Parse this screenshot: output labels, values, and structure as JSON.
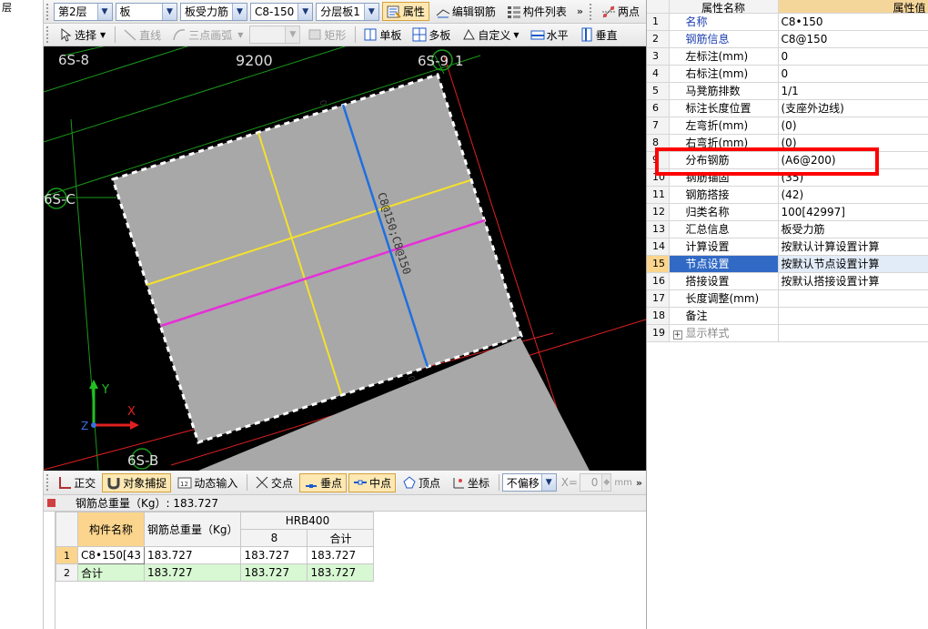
{
  "left_strip": {
    "label": "层"
  },
  "toolbar1": {
    "floor": "第2层",
    "component_type": "板",
    "rebar_type": "板受力筋",
    "rebar_spec": "C8-150",
    "layer": "分层板1",
    "properties_label": "属性",
    "edit_rebar_label": "编辑钢筋",
    "component_list_label": "构件列表",
    "more": "»",
    "two_point_label": "两点"
  },
  "toolbar2": {
    "select_label": "选择",
    "line_label": "直线",
    "arc_label": "三点画弧",
    "rect_label": "矩形",
    "single_label": "单板",
    "multi_label": "多板",
    "custom_label": "自定义",
    "horizontal_label": "水平",
    "vertical_label": "垂直"
  },
  "canvas": {
    "axis_labels": {
      "top_left": "6S-8",
      "top_right": "6S-9",
      "top_right_suffix": "1",
      "dimension": "9200",
      "left": "6S-C",
      "bottom": "6S-B"
    },
    "rebar_label": "C8@150;C8@150",
    "zero_labels": [
      "0",
      "0"
    ],
    "coords": {
      "y": "Y",
      "x": "X",
      "z": "Z"
    },
    "colors": {
      "slab": "#a8a8a8",
      "yellow_rebar": "#f5e12a",
      "magenta_rebar": "#e62fd8",
      "blue_rebar": "#1e6fe0",
      "axis_green": "#1a9a1a",
      "axis_red": "#e02020"
    }
  },
  "toolbar3": {
    "orthogonal_label": "正交",
    "snap_label": "对象捕捉",
    "dynamic_input_label": "动态输入",
    "intersection_label": "交点",
    "perpendicular_label": "垂点",
    "midpoint_label": "中点",
    "vertex_label": "顶点",
    "coordinate_label": "坐标",
    "offset_value": "不偏移",
    "x_label": "X=",
    "x_value": "0",
    "unit": "mm"
  },
  "info_bar": {
    "text": "钢筋总重量（Kg）: 183.727"
  },
  "steel_table": {
    "headers": {
      "component": "构件名称",
      "total_weight": "钢筋总重量（Kg）",
      "grade": "HRB400",
      "dia": "8",
      "sum": "合计"
    },
    "rows": [
      {
        "index": "1",
        "name": "C8•150[43",
        "total": "183.727",
        "d8": "183.727",
        "sum": "183.727"
      },
      {
        "index": "2",
        "name": "合计",
        "total": "183.727",
        "d8": "183.727",
        "sum": "183.727"
      }
    ]
  },
  "property_panel": {
    "header_name": "属性名称",
    "header_value": "属性值",
    "rows": [
      {
        "num": "1",
        "name": "名称",
        "value": "C8•150",
        "style": "blue"
      },
      {
        "num": "2",
        "name": "钢筋信息",
        "value": "C8@150",
        "style": "blue"
      },
      {
        "num": "3",
        "name": "左标注(mm)",
        "value": "0",
        "style": ""
      },
      {
        "num": "4",
        "name": "右标注(mm)",
        "value": "0",
        "style": ""
      },
      {
        "num": "5",
        "name": "马凳筋排数",
        "value": "1/1",
        "style": ""
      },
      {
        "num": "6",
        "name": "标注长度位置",
        "value": "(支座外边线)",
        "style": ""
      },
      {
        "num": "7",
        "name": "左弯折(mm)",
        "value": "(0)",
        "style": ""
      },
      {
        "num": "8",
        "name": "右弯折(mm)",
        "value": "(0)",
        "style": ""
      },
      {
        "num": "9",
        "name": "分布钢筋",
        "value": "(A6@200)",
        "style": ""
      },
      {
        "num": "10",
        "name": "钢筋锚固",
        "value": "(35)",
        "style": ""
      },
      {
        "num": "11",
        "name": "钢筋搭接",
        "value": "(42)",
        "style": ""
      },
      {
        "num": "12",
        "name": "归类名称",
        "value": "100[42997]",
        "style": ""
      },
      {
        "num": "13",
        "name": "汇总信息",
        "value": "板受力筋",
        "style": ""
      },
      {
        "num": "14",
        "name": "计算设置",
        "value": "按默认计算设置计算",
        "style": ""
      },
      {
        "num": "15",
        "name": "节点设置",
        "value": "按默认节点设置计算",
        "style": "sel"
      },
      {
        "num": "16",
        "name": "搭接设置",
        "value": "按默认搭接设置计算",
        "style": ""
      },
      {
        "num": "17",
        "name": "长度调整(mm)",
        "value": "",
        "style": ""
      },
      {
        "num": "18",
        "name": "备注",
        "value": "",
        "style": ""
      },
      {
        "num": "19",
        "name": "显示样式",
        "value": "",
        "style": "gray"
      }
    ]
  }
}
